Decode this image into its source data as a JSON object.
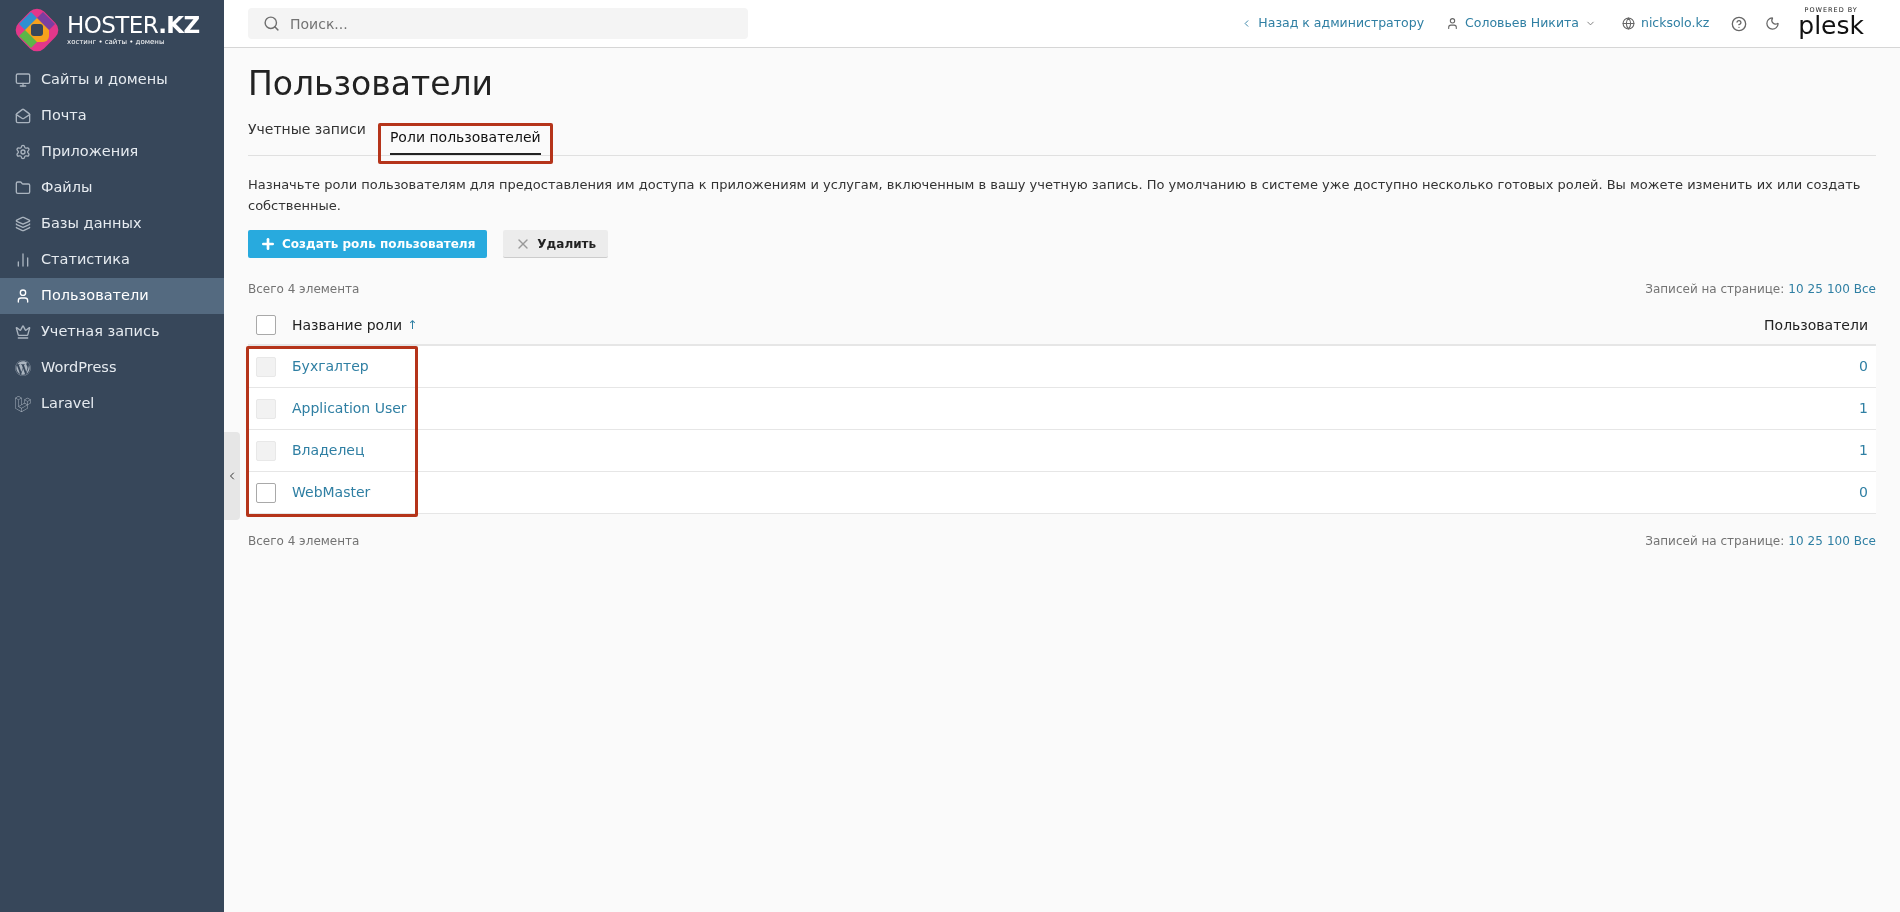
{
  "logo": {
    "name": "HOSTER**.KZ**",
    "tagline": "хостинг • сайты • домены"
  },
  "sidebar": {
    "items": [
      {
        "label": "Сайты и домены",
        "selected": false
      },
      {
        "label": "Почта",
        "selected": false
      },
      {
        "label": "Приложения",
        "selected": false
      },
      {
        "label": "Файлы",
        "selected": false
      },
      {
        "label": "Базы данных",
        "selected": false
      },
      {
        "label": "Статистика",
        "selected": false
      },
      {
        "label": "Пользователи",
        "selected": true
      },
      {
        "label": "Учетная запись",
        "selected": false
      },
      {
        "label": "WordPress",
        "selected": false
      },
      {
        "label": "Laravel",
        "selected": false
      }
    ]
  },
  "search": {
    "placeholder": "Поиск..."
  },
  "topbar": {
    "back": "Назад к администратору",
    "user": "Соловьев Никита",
    "domain": "nicksolo.kz",
    "powered_by": "POWERED BY",
    "plesk": "plesk"
  },
  "page": {
    "title": "Пользователи",
    "tabs": [
      {
        "label": "Учетные записи",
        "selected": false
      },
      {
        "label": "Роли пользователей",
        "selected": true
      }
    ],
    "description": "Назначьте роли пользователям для предоставления им доступа к приложениям и услугам, включенным в вашу учетную запись. По умолчанию в системе уже доступно несколько готовых ролей. Вы можете изменить их или создать собственные.",
    "buttons": {
      "create": "Создать роль пользователя",
      "delete": "Удалить"
    },
    "total_top": "Всего 4 элемента",
    "total_bottom": "Всего 4 элемента",
    "per_page_top": {
      "label": "Записей на странице:",
      "options": [
        "10",
        "25",
        "100",
        "Все"
      ]
    },
    "per_page_bottom": {
      "label": "Записей на странице:",
      "options": [
        "10",
        "25",
        "100",
        "Все"
      ]
    },
    "table": {
      "columns": [
        "Название роли",
        "Пользователи"
      ],
      "sort_mark": "↑",
      "header_checked": false,
      "rows": [
        {
          "name": "Бухгалтер",
          "users": "0",
          "disabled": true,
          "checked": false
        },
        {
          "name": "Application User",
          "users": "1",
          "disabled": true,
          "checked": false
        },
        {
          "name": "Владелец",
          "users": "1",
          "disabled": true,
          "checked": false
        },
        {
          "name": "WebMaster",
          "users": "0",
          "disabled": false,
          "checked": false
        }
      ]
    }
  }
}
